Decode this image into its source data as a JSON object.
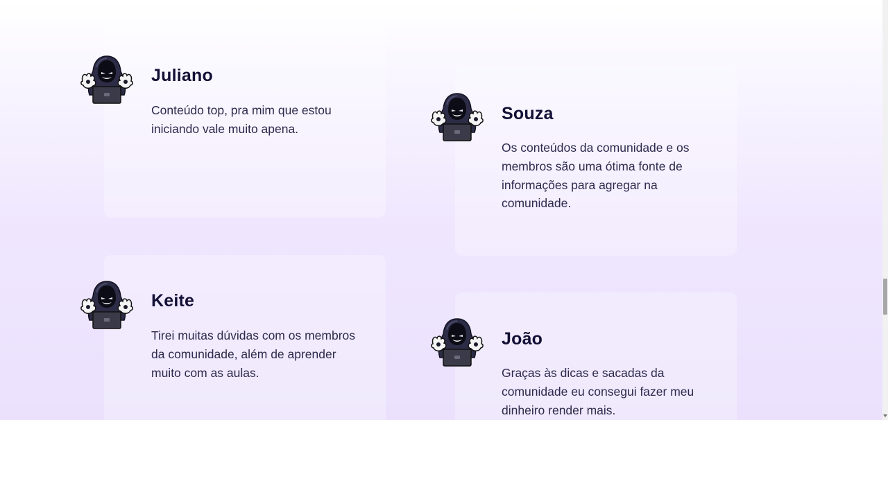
{
  "testimonials": [
    {
      "name": "Juliano",
      "text": "Conteúdo top, pra mim que estou iniciando vale muito apena.",
      "avatar_icon": "hooded-hacker-icon"
    },
    {
      "name": "Souza",
      "text": "Os conteúdos da comunidade e os membros são uma ótima fonte de informações para agregar na comunidade.",
      "avatar_icon": "hooded-hacker-icon"
    },
    {
      "name": "Keite",
      "text": "Tirei muitas dúvidas com os membros da comunidade, além de aprender muito com as aulas.",
      "avatar_icon": "hooded-hacker-icon"
    },
    {
      "name": "João",
      "text": "Graças às dicas e sacadas da comunidade eu consegui fazer meu dinheiro render mais.",
      "avatar_icon": "hooded-hacker-icon"
    }
  ],
  "colors": {
    "name": "#131036",
    "body_text": "#2d2a4d",
    "background_top": "#ffffff",
    "background_bottom": "#ebe1fd"
  }
}
